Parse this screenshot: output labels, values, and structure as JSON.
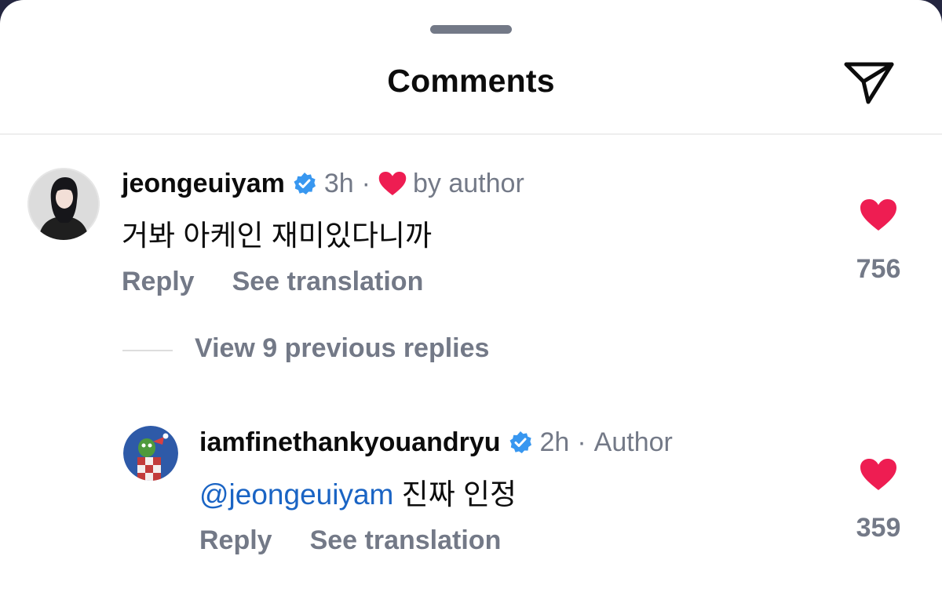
{
  "sheet": {
    "title": "Comments"
  },
  "colors": {
    "like_red": "#ee1d52",
    "verified_blue": "#3897f0",
    "mention_blue": "#1a64c4",
    "muted_gray": "#737987"
  },
  "comment": {
    "username": "jeongeuiyam",
    "time": "3h",
    "separator": "·",
    "liked_by_author": "by author",
    "text": "거봐 아케인 재미있다니까",
    "reply_label": "Reply",
    "translate_label": "See translation",
    "likes": "756"
  },
  "view_replies": "View 9 previous replies",
  "reply": {
    "username": "iamfinethankyouandryu",
    "time": "2h",
    "separator": "·",
    "author_tag": "Author",
    "mention": "@jeongeuiyam",
    "text": " 진짜 인정",
    "reply_label": "Reply",
    "translate_label": "See translation",
    "likes": "359"
  },
  "icons": {
    "share": "paper-plane-icon",
    "verified": "verified-badge-icon",
    "like": "heart-icon"
  }
}
